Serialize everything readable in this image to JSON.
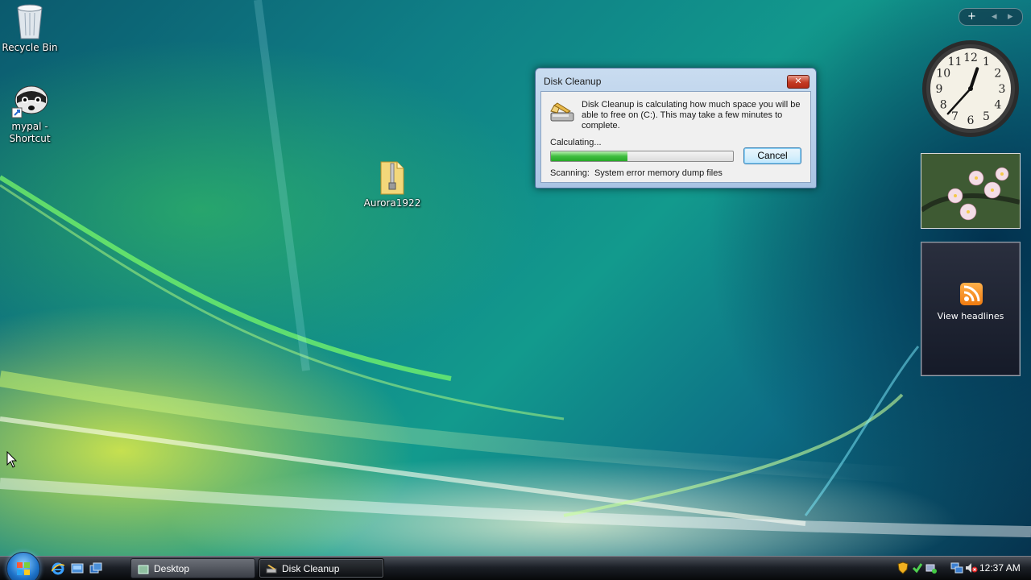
{
  "desktop": {
    "icons": [
      {
        "label": "Recycle Bin"
      },
      {
        "label": "mypal - Shortcut"
      },
      {
        "label": "Aurora1922"
      }
    ]
  },
  "dialog": {
    "title": "Disk Cleanup",
    "close_glyph": "✕",
    "message": "Disk Cleanup is calculating how much space you will be able to free on  (C:). This may take a few minutes to complete.",
    "status": "Calculating...",
    "progress_fraction": 0.42,
    "cancel_label": "Cancel",
    "scanning_label": "Scanning:",
    "scanning_value": "System error memory dump files",
    "icon": "disk-cleanup-icon"
  },
  "sidebar": {
    "add_glyph": "+",
    "prev_glyph": "◂",
    "next_glyph": "▸",
    "clock": {
      "hour": 12,
      "minute": 37,
      "numbers": [
        "12",
        "1",
        "2",
        "3",
        "4",
        "5",
        "6",
        "7",
        "8",
        "9",
        "10",
        "11"
      ]
    },
    "feeds": {
      "label": "View headlines"
    }
  },
  "taskbar": {
    "tasks": [
      {
        "label": "Desktop"
      },
      {
        "label": "Disk Cleanup"
      }
    ],
    "clock": "12:37 AM"
  },
  "colors": {
    "progress": "#3fbd3f",
    "close_button": "#c43a23",
    "accent": "#3c7fb1"
  }
}
